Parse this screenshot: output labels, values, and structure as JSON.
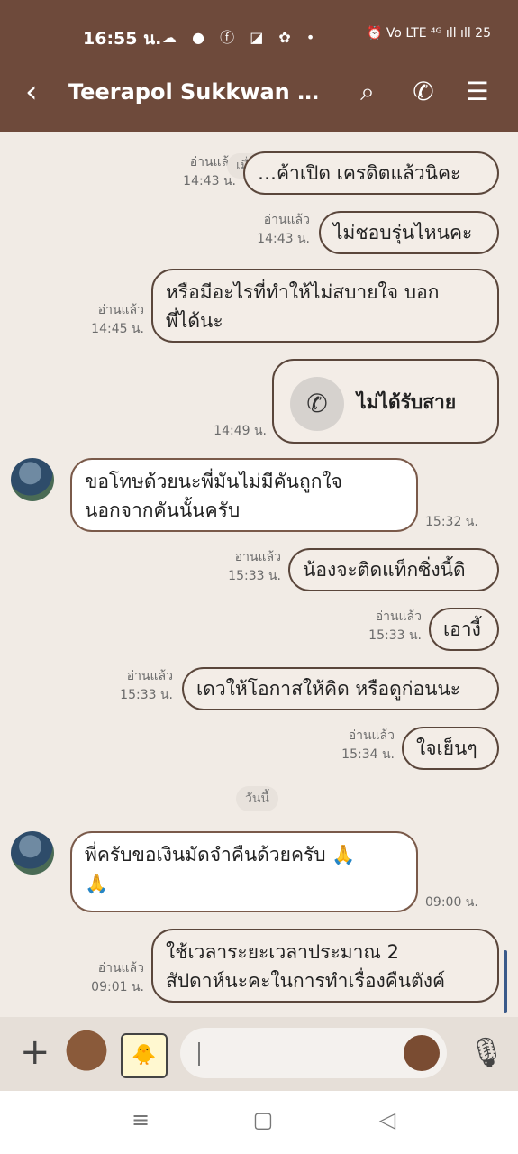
{
  "status": {
    "time": "16:55 น.",
    "app_icons": "☁ ● ⓕ ◪ ✿ •",
    "system": "⏰ Vo LTE ⁴ᴳ ıll ıll 25"
  },
  "header": {
    "back_icon": "‹",
    "title": "Teerapol Sukkwan 🍑...",
    "search_icon": "⌕",
    "call_icon": "✆",
    "menu_icon": "☰"
  },
  "chat": {
    "yesterday_label": "เมื่อวาน",
    "today_label": "วันนี้",
    "messages": [
      {
        "text": "…ค้าเปิด เครดิตแล้วนิคะ",
        "read": "อ่านแล้ว",
        "time": "14:43 น."
      },
      {
        "text": "ไม่ชอบรุ่นไหนคะ",
        "read": "อ่านแล้ว",
        "time": "14:43 น."
      },
      {
        "line1": "หรือมีอะไรที่ทำให้ไม่สบายใจ บอก",
        "line2": "พี่ได้นะ",
        "read": "อ่านแล้ว",
        "time": "14:45 น."
      },
      {
        "call_text": "ไม่ได้รับสาย",
        "time": "14:49 น."
      },
      {
        "line1": "ขอโทษด้วยนะพี่มันไม่มีคันถูกใจ",
        "line2": "นอกจากคันนั้นครับ",
        "time": "15:32 น."
      },
      {
        "text": "น้องจะติดแท็กซิ่งนี้ดิ",
        "read": "อ่านแล้ว",
        "time": "15:33 น."
      },
      {
        "text": "เอางี้",
        "read": "อ่านแล้ว",
        "time": "15:33 น."
      },
      {
        "text": "เดวให้โอกาสให้คิด หรือดูก่อนนะ",
        "read": "อ่านแล้ว",
        "time": "15:33 น."
      },
      {
        "text": "ใจเย็นๆ",
        "read": "อ่านแล้ว",
        "time": "15:34 น."
      },
      {
        "line1": "พี่ครับขอเงินมัดจำคืนด้วยครับ 🙏",
        "line2": "🙏",
        "time": "09:00 น."
      },
      {
        "line1": "ใช้เวลาระยะเวลาประมาณ 2",
        "line2": "สัปดาห์นะคะในการทำเรื่องคืนตังค์",
        "read": "อ่านแล้ว",
        "time": "09:01 น."
      }
    ]
  },
  "input": {
    "plus_icon": "+",
    "placeholder": "",
    "mic_icon": "🎙"
  },
  "nav": {
    "menu_icon": "≡",
    "home_icon": "▢",
    "back_icon": "◁"
  }
}
